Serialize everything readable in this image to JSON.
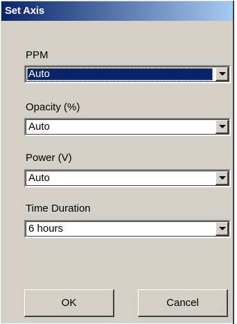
{
  "window": {
    "title": "Set Axis"
  },
  "fields": [
    {
      "label": "PPM",
      "value": "Auto",
      "selected": true
    },
    {
      "label": "Opacity (%)",
      "value": "Auto",
      "selected": false
    },
    {
      "label": "Power (V)",
      "value": "Auto",
      "selected": false
    },
    {
      "label": "Time Duration",
      "value": "6 hours",
      "selected": false
    }
  ],
  "buttons": {
    "ok_label": "OK",
    "cancel_label": "Cancel"
  },
  "icons": {
    "dropdown": "chevron-down-icon"
  },
  "colors": {
    "titlebar_start": "#0a246a",
    "titlebar_end": "#a6caf0",
    "dialog_face": "#d4d0c8",
    "selection": "#0a246a"
  }
}
